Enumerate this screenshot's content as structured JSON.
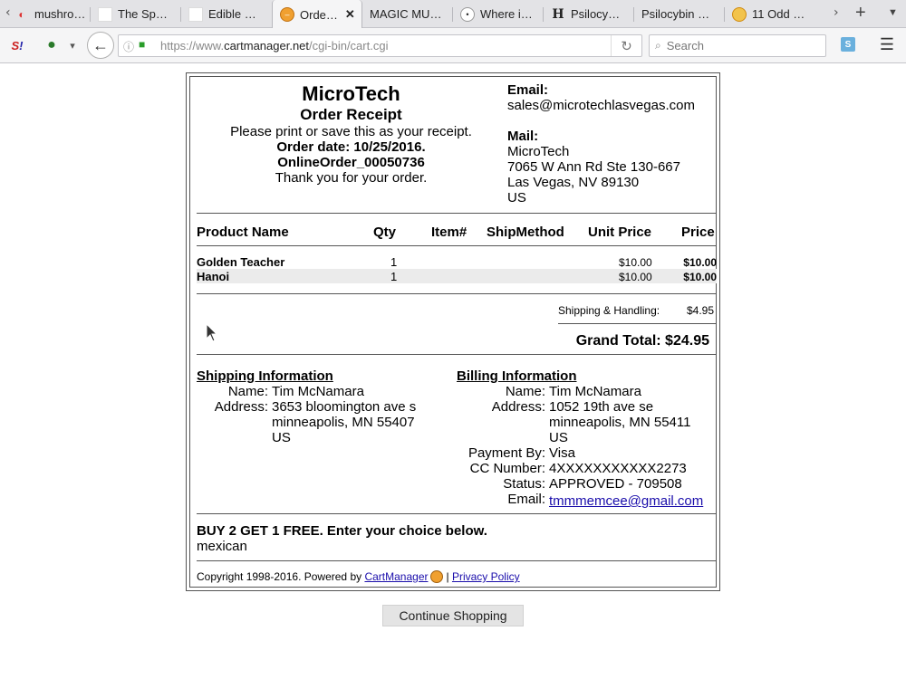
{
  "browser": {
    "tabs": [
      {
        "title": "mushro…",
        "icon": "pocket-icon"
      },
      {
        "title": "The Sp…",
        "icon": "blank-page-icon"
      },
      {
        "title": "Edible …",
        "icon": "blank-page-icon"
      },
      {
        "title": "Orde…",
        "icon": "cartmanager-icon",
        "active": true
      },
      {
        "title": "MAGIC MU…",
        "icon": "none"
      },
      {
        "title": "Where i…",
        "icon": "reddit-icon"
      },
      {
        "title": "Psilocy…",
        "icon": "wikipedia-icon"
      },
      {
        "title": "Psilocybin …",
        "icon": "none"
      },
      {
        "title": "11 Odd …",
        "icon": "odd-icon"
      }
    ],
    "url_prefix": "https://www.",
    "url_host": "cartmanager.net",
    "url_path": "/cgi-bin/cart.cgi",
    "search_placeholder": "Search"
  },
  "receipt": {
    "company": "MicroTech",
    "subtitle": "Order Receipt",
    "instruction": "Please print or save this as your receipt.",
    "order_date": "Order date: 10/25/2016.",
    "order_id": "OnlineOrder_00050736",
    "thanks": "Thank you for your order.",
    "email_label": "Email:",
    "email": "sales@microtechlasvegas.com",
    "mail_label": "Mail:",
    "mail_lines": [
      "MicroTech",
      "7065 W Ann Rd Ste 130-667",
      "Las Vegas, NV 89130",
      "US"
    ],
    "columns": [
      "Product Name",
      "Qty",
      "Item#",
      "ShipMethod",
      "Unit Price",
      "Price"
    ],
    "items": [
      {
        "name": "Golden Teacher",
        "qty": "1",
        "item": "",
        "ship": "",
        "unit": "$10.00",
        "price": "$10.00"
      },
      {
        "name": "Hanoi",
        "qty": "1",
        "item": "",
        "ship": "",
        "unit": "$10.00",
        "price": "$10.00"
      }
    ],
    "shipping_label": "Shipping & Handling:",
    "shipping_value": "$4.95",
    "grand_total": "Grand Total: $24.95",
    "shipping_info": {
      "heading": "Shipping Information",
      "name_label": "Name:",
      "name": "Tim McNamara",
      "address_label": "Address:",
      "address_lines": [
        "3653 bloomington ave s",
        "minneapolis, MN 55407",
        "US"
      ]
    },
    "billing_info": {
      "heading": "Billing Information",
      "name_label": "Name:",
      "name": "Tim McNamara",
      "address_label": "Address:",
      "address_lines": [
        "1052 19th ave se",
        "minneapolis, MN 55411",
        "US"
      ],
      "payment_label": "Payment By:",
      "payment": "Visa",
      "cc_label": "CC Number:",
      "cc": "4XXXXXXXXXXX2273",
      "status_label": "Status:",
      "status": "APPROVED - 709508",
      "email_label": "Email:",
      "email": "tmmmemcee@gmail.com"
    },
    "promo_heading": "BUY 2 GET 1 FREE. Enter your choice below.",
    "promo_choice": "mexican",
    "footer_copyright": "Copyright 1998-2016. Powered by ",
    "footer_brand": "CartManager",
    "footer_sep": "|",
    "footer_privacy": "Privacy Policy"
  },
  "continue_button": "Continue Shopping"
}
